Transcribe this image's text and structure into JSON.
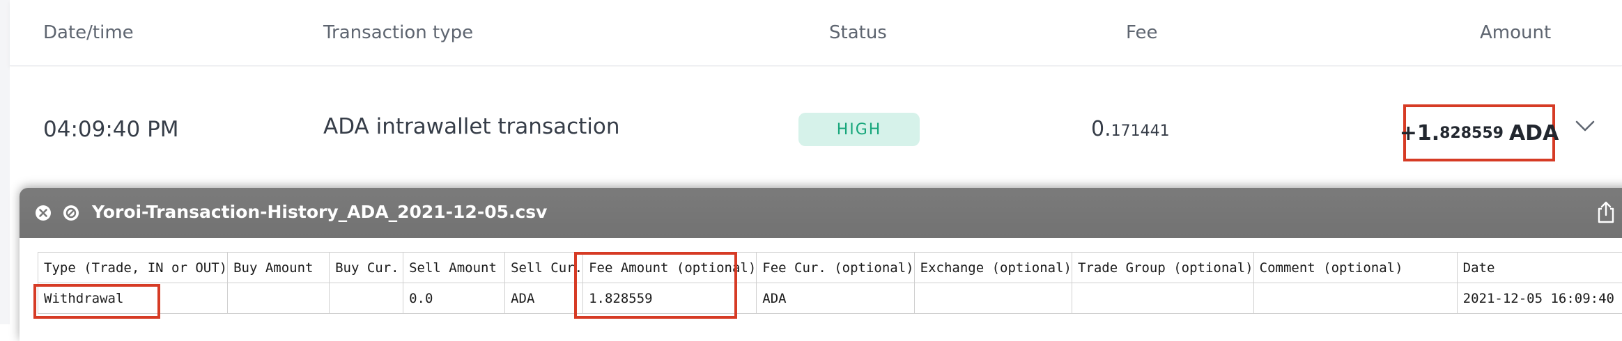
{
  "table_header": {
    "date_time": "Date/time",
    "transaction_type": "Transaction type",
    "status": "Status",
    "fee": "Fee",
    "amount": "Amount"
  },
  "transaction": {
    "time": "04:09:40 PM",
    "type": "ADA intrawallet transaction",
    "status": "HIGH",
    "fee_whole": "0.",
    "fee_decimals": "171441",
    "amount_whole": "+1.",
    "amount_decimals": "828559",
    "amount_currency": "ADA"
  },
  "csv_window": {
    "title": "Yoroi-Transaction-History_ADA_2021-12-05.csv",
    "columns": [
      "Type (Trade, IN or OUT)",
      "Buy Amount",
      "Buy Cur.",
      "Sell Amount",
      "Sell Cur.",
      "Fee Amount (optional)",
      "Fee Cur. (optional)",
      "Exchange (optional)",
      "Trade Group (optional)",
      "Comment (optional)",
      "Date"
    ],
    "rows": [
      [
        "Withdrawal",
        "",
        "",
        "0.0",
        "ADA",
        "1.828559",
        "ADA",
        "",
        "",
        "",
        "2021-12-05 16:09:40"
      ]
    ]
  },
  "colors": {
    "highlight_red": "#d63b25",
    "status_green": "#17a67b",
    "status_bg": "#d6f2ea",
    "titlebar_gray": "#767676"
  },
  "icons": [
    "chevron-down-icon",
    "close-icon",
    "block-icon",
    "share-icon"
  ]
}
